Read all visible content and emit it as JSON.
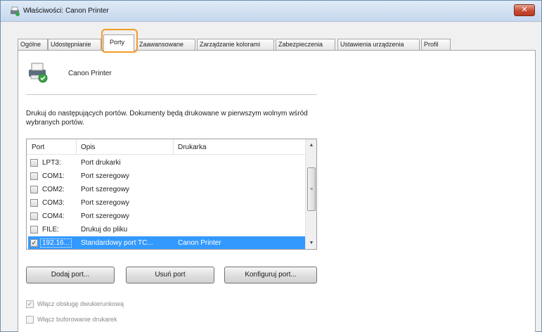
{
  "window": {
    "title": "Właściwości: Canon Printer",
    "close_label": "✕"
  },
  "tabs": [
    {
      "label": "Ogólne"
    },
    {
      "label": "Udostępnianie"
    },
    {
      "label": "Porty"
    },
    {
      "label": "Zaawansowane"
    },
    {
      "label": "Zarządzanie kolorami"
    },
    {
      "label": "Zabezpieczenia"
    },
    {
      "label": "Ustawienia urządzenia"
    },
    {
      "label": "Profil"
    }
  ],
  "printer": {
    "name": "Canon Printer"
  },
  "description": "Drukuj do następujących portów. Dokumenty będą drukowane w pierwszym wolnym wśród wybranych portów.",
  "ports_table": {
    "columns": [
      "Port",
      "Opis",
      "Drukarka"
    ],
    "rows": [
      {
        "port": "LPT3:",
        "desc": "Port drukarki",
        "printer": "",
        "checked": ""
      },
      {
        "port": "COM1:",
        "desc": "Port szeregowy",
        "printer": "",
        "checked": ""
      },
      {
        "port": "COM2:",
        "desc": "Port szeregowy",
        "printer": "",
        "checked": ""
      },
      {
        "port": "COM3:",
        "desc": "Port szeregowy",
        "printer": "",
        "checked": ""
      },
      {
        "port": "COM4:",
        "desc": "Port szeregowy",
        "printer": "",
        "checked": ""
      },
      {
        "port": "FILE:",
        "desc": "Drukuj do pliku",
        "printer": "",
        "checked": ""
      },
      {
        "port": "192.16...",
        "desc": "Standardowy port TC...",
        "printer": "Canon Printer",
        "checked": "✓"
      }
    ]
  },
  "buttons": {
    "add_port": "Dodaj port...",
    "delete_port": "Usuń port",
    "configure_port": "Konfiguruj port..."
  },
  "options": {
    "bidirectional": {
      "label": "Włącz obsługę dwukierunkową",
      "checked": "✓"
    },
    "pooling": {
      "label": "Włącz buforowanie drukarek",
      "checked": ""
    }
  },
  "colors": {
    "selection": "#3399ff",
    "highlight": "#f29b2a",
    "close": "#c74b33"
  }
}
